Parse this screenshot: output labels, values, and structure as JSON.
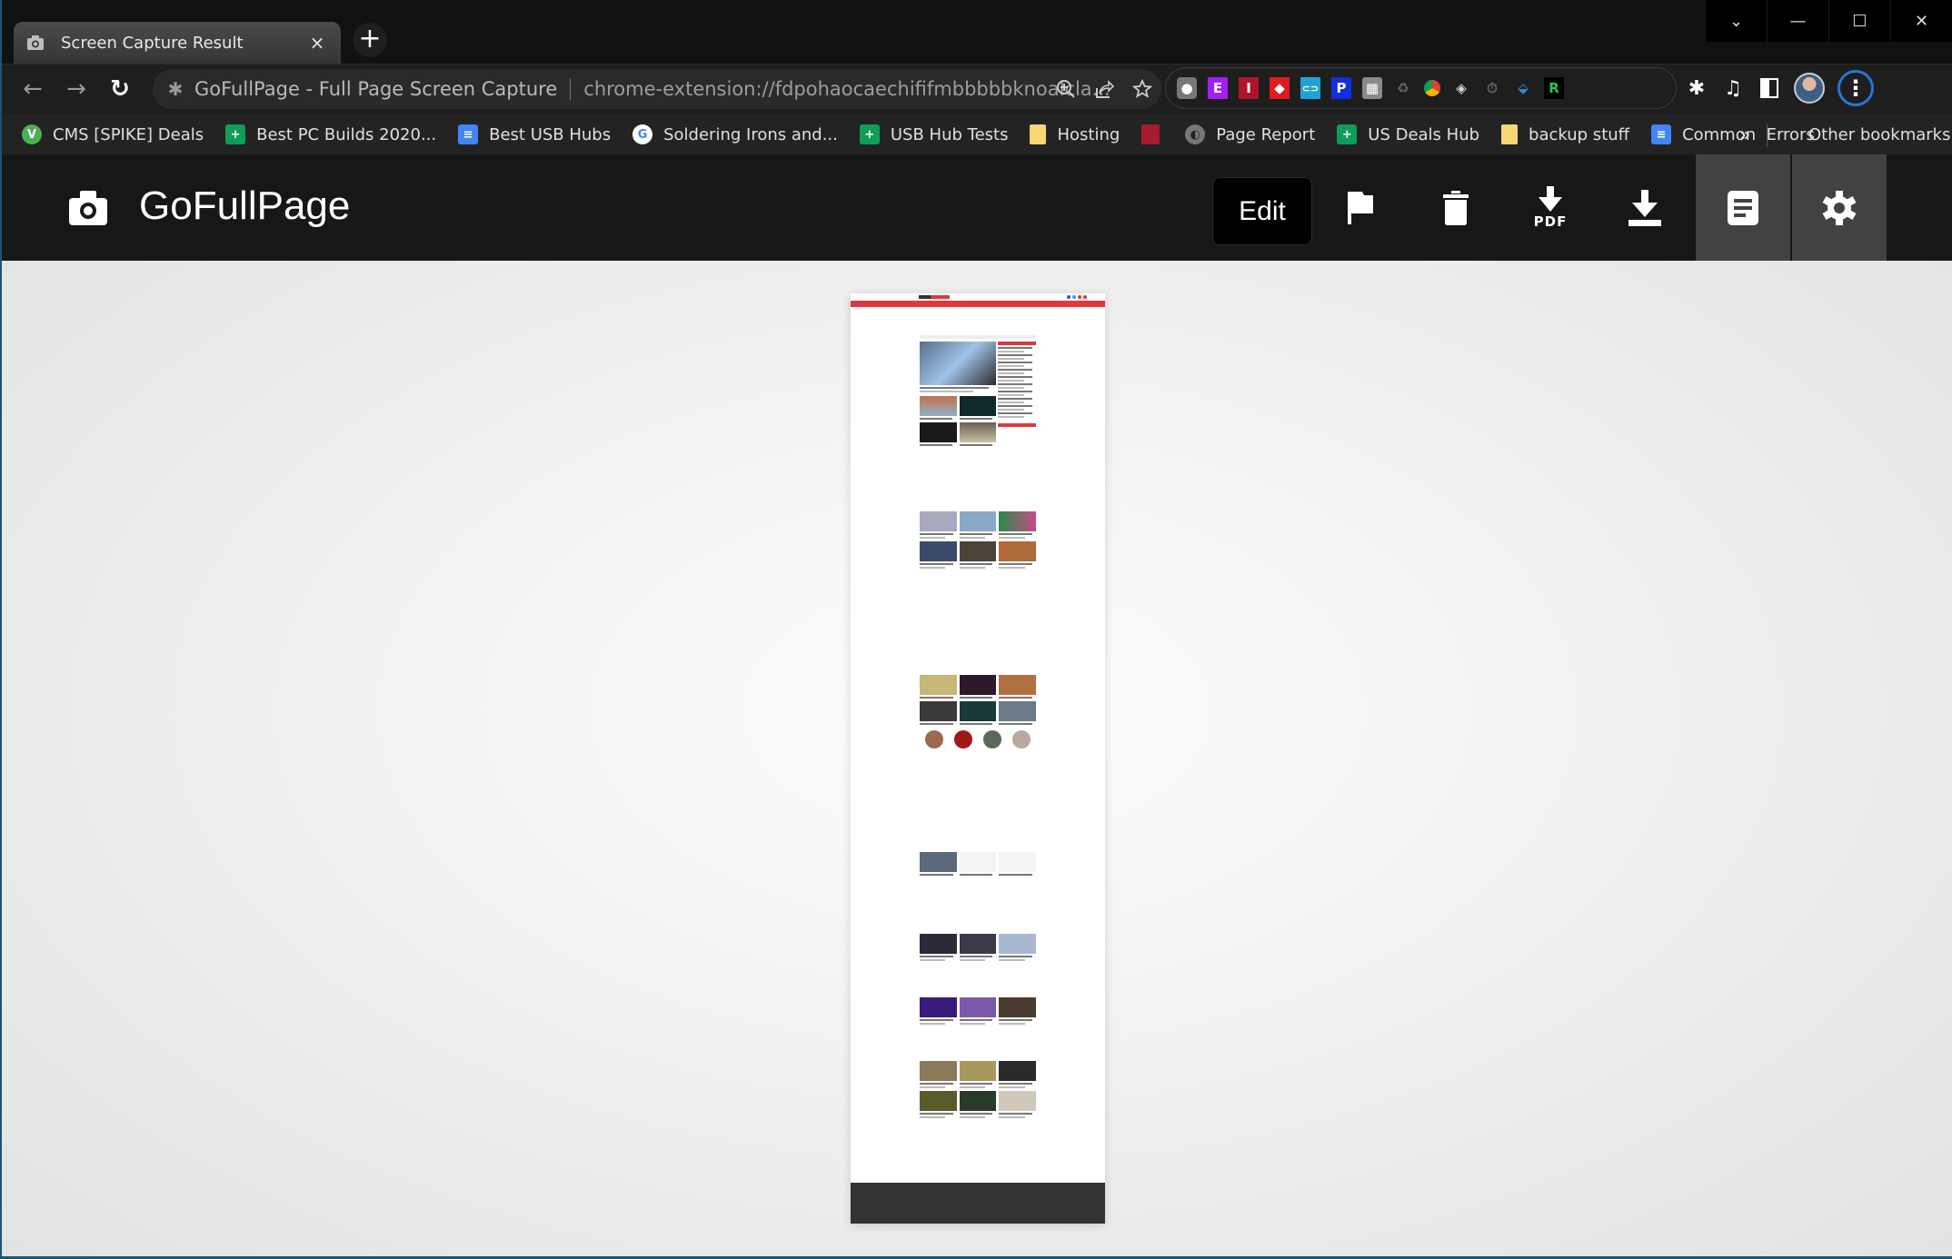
{
  "window": {
    "controls": {
      "tab_search": "⌄",
      "minimize": "—",
      "maximize": "☐",
      "close": "✕"
    }
  },
  "tab": {
    "title": "Screen Capture Result",
    "close": "×",
    "new_tab": "+"
  },
  "toolbar": {
    "back": "←",
    "forward": "→",
    "reload": "↻",
    "site_name": "GoFullPage - Full Page Screen Capture",
    "url": "chrome-extension://fdpohaocaechififmbbbbbknoalcla...",
    "extensions": [
      {
        "name": "gofullpage",
        "glyph": "📷",
        "color": "#777777"
      },
      {
        "name": "e-extension",
        "glyph": "E",
        "color": "#a020f0"
      },
      {
        "name": "i-extension",
        "glyph": "I",
        "color": "#b0142c"
      },
      {
        "name": "tag-extension",
        "glyph": "◆",
        "color": "#e01b1b"
      },
      {
        "name": "link-extension",
        "glyph": "⊂⊃",
        "color": "#1fa2d8"
      },
      {
        "name": "p-extension",
        "glyph": "P",
        "color": "#1030e0"
      },
      {
        "name": "camel-extension",
        "glyph": "▦",
        "color": "#8a8a8a"
      },
      {
        "name": "recycle-extension",
        "glyph": "♻",
        "color": "#1e1e1e"
      },
      {
        "name": "chrome-extension",
        "glyph": "●",
        "color": "#1e1e1e"
      },
      {
        "name": "cube-extension",
        "glyph": "◈",
        "color": "#1e1e1e"
      },
      {
        "name": "timer-extension",
        "glyph": "⏱",
        "color": "#1e1e1e"
      },
      {
        "name": "ice-cream-extension",
        "glyph": "⬙",
        "color": "#1e1e1e"
      },
      {
        "name": "r-extension",
        "glyph": "R",
        "color": "#000000"
      }
    ]
  },
  "bookmarks": {
    "items": [
      {
        "label": "CMS [SPIKE] Deals",
        "icon": "green-circle",
        "glyph": "V"
      },
      {
        "label": "Best PC Builds 2020...",
        "icon": "sheet",
        "glyph": "+"
      },
      {
        "label": "Best USB Hubs",
        "icon": "doc",
        "glyph": "≡"
      },
      {
        "label": "Soldering Irons and...",
        "icon": "google",
        "glyph": "G"
      },
      {
        "label": "USB Hub Tests",
        "icon": "sheet",
        "glyph": "+"
      },
      {
        "label": "Hosting",
        "icon": "folder",
        "glyph": ""
      },
      {
        "label": "",
        "icon": "red-flag",
        "glyph": ""
      },
      {
        "label": "Page Report",
        "icon": "globe",
        "glyph": "◐"
      },
      {
        "label": "US Deals Hub",
        "icon": "sheet",
        "glyph": "+"
      },
      {
        "label": "backup stuff",
        "icon": "folder",
        "glyph": ""
      },
      {
        "label": "Common  Errors",
        "icon": "doc",
        "glyph": "≡"
      }
    ],
    "more": "»",
    "other": "Other bookmarks"
  },
  "app": {
    "title": "GoFullPage",
    "edit_label": "Edit",
    "pdf_label": "PDF"
  },
  "capture": {
    "site_logo": "tom'sHARDWARE",
    "accent_color": "#e0383e"
  }
}
